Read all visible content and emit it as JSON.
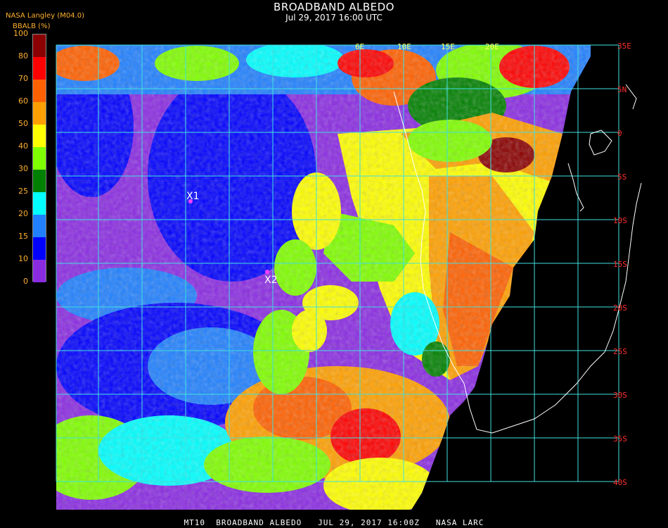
{
  "header": {
    "title": "BROADBAND ALBEDO",
    "subtitle": "Jul 29, 2017 16:00 UTC",
    "org": "NASA Langley (M04.0)",
    "variable": "BBALB (%)"
  },
  "colorbar": {
    "levels": [
      {
        "label": "0",
        "color": "#8a2be2"
      },
      {
        "label": "10",
        "color": "#0000ff"
      },
      {
        "label": "15",
        "color": "#2080ff"
      },
      {
        "label": "20",
        "color": "#00ffff"
      },
      {
        "label": "25",
        "color": "#008000"
      },
      {
        "label": "30",
        "color": "#80ff00"
      },
      {
        "label": "40",
        "color": "#ffff00"
      },
      {
        "label": "50",
        "color": "#ffa000"
      },
      {
        "label": "60",
        "color": "#ff6000"
      },
      {
        "label": "70",
        "color": "#ff0000"
      },
      {
        "label": "80",
        "color": "#8b0000"
      },
      {
        "label": "100",
        "color": "#000000"
      }
    ]
  },
  "map": {
    "lat_labels": [
      "35E",
      "5N",
      "0",
      "5S",
      "10S",
      "15S",
      "20S",
      "25S",
      "30S",
      "35S",
      "40S"
    ],
    "lon_labels": [
      "6E",
      "10E",
      "15E",
      "20E"
    ],
    "markers": [
      {
        "label": "X1",
        "color": "#ff40ff"
      },
      {
        "label": "X2",
        "color": "#ff40ff"
      }
    ]
  },
  "footer": {
    "text": "MT10  BROADBAND ALBEDO   JUL 29, 2017 16:00Z   NASA LARC"
  }
}
